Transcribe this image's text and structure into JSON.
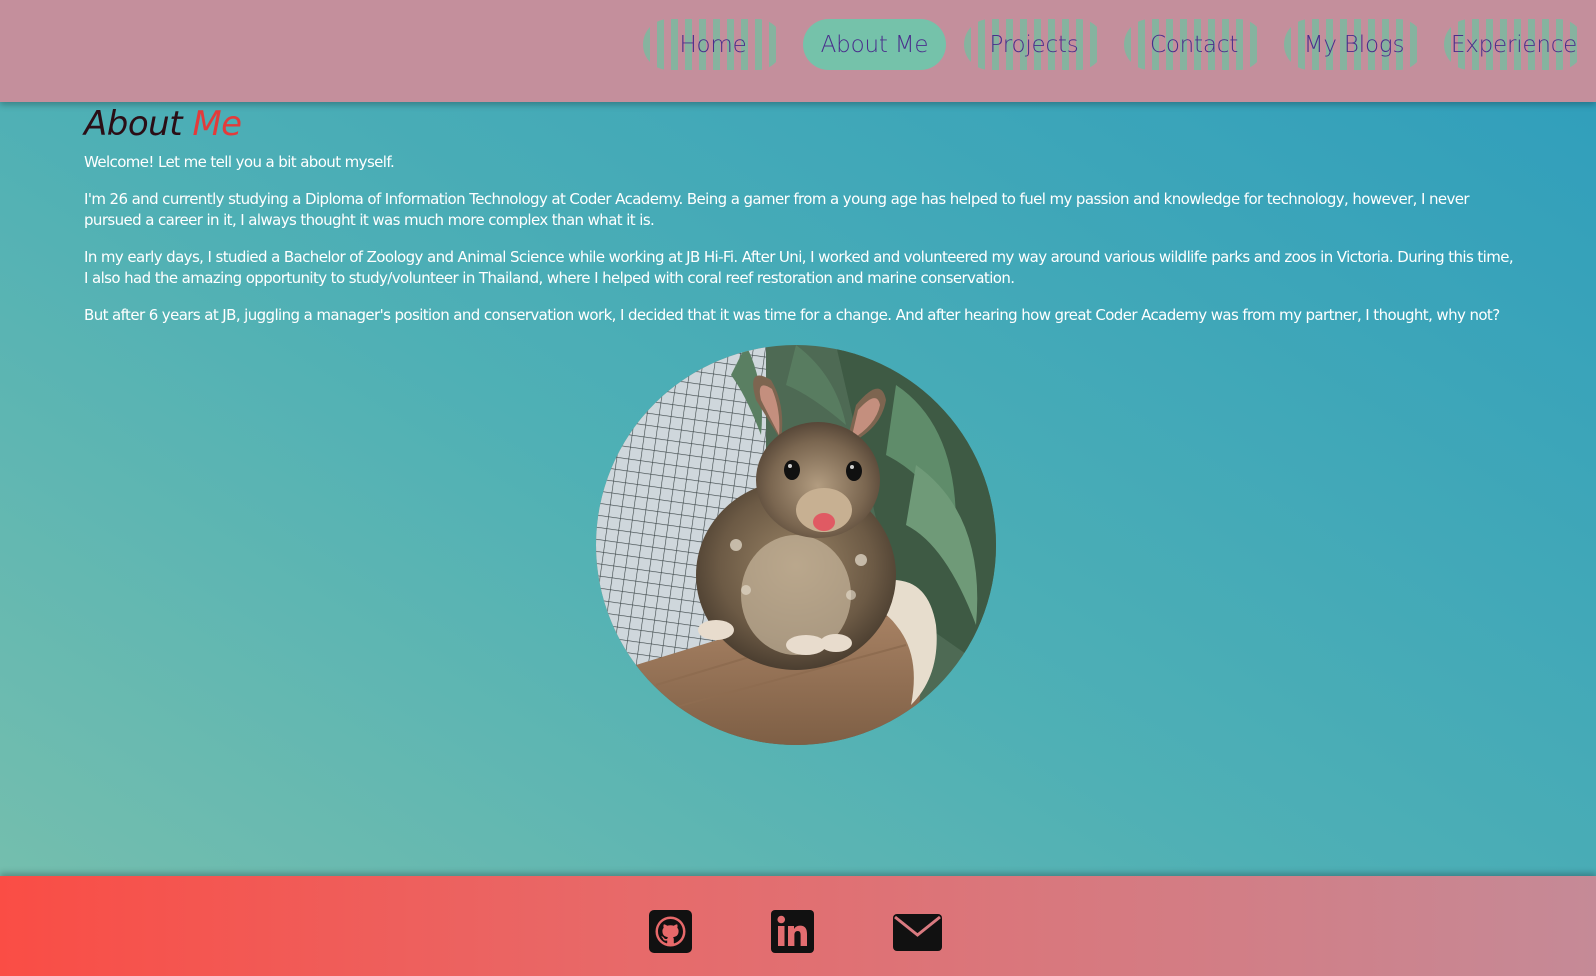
{
  "nav": {
    "items": [
      {
        "label": "Home"
      },
      {
        "label": "About Me"
      },
      {
        "label": "Projects"
      },
      {
        "label": "Contact"
      },
      {
        "label": "My Blogs"
      },
      {
        "label": "Experience"
      }
    ],
    "active": "About Me"
  },
  "main": {
    "title_part1": "About",
    "title_part2": "Me",
    "paragraphs": [
      "Welcome! Let me tell you a bit about myself.",
      "I'm 26 and currently studying a Diploma of Information Technology at Coder Academy. Being a gamer from a young age has helped to fuel my passion and knowledge for technology, however, I never pursued a career in it, I always thought it was much more complex than what it is.",
      "In my early days, I studied a Bachelor of Zoology and Animal Science while working at JB Hi-Fi. After Uni, I worked and volunteered my way around various wildlife parks and zoos in Victoria. During this time, I also had the amazing opportunity to study/volunteer in Thailand, where I helped with coral reef restoration and marine conservation.",
      "But after 6 years at JB, juggling a manager's position and conservation work, I decided that it was time for a change. And after hearing how great Coder Academy was from my partner, I thought, why not?"
    ]
  },
  "footer": {
    "icons": [
      "github-icon",
      "linkedin-icon",
      "email-icon"
    ]
  },
  "colors": {
    "header_bg": "#c48f9c",
    "nav_text": "#4a2e8c",
    "nav_active_bg": "#75c2aa",
    "title_accent": "#e33b3b",
    "footer_left": "#fa4d45",
    "footer_right": "#c58a97"
  }
}
